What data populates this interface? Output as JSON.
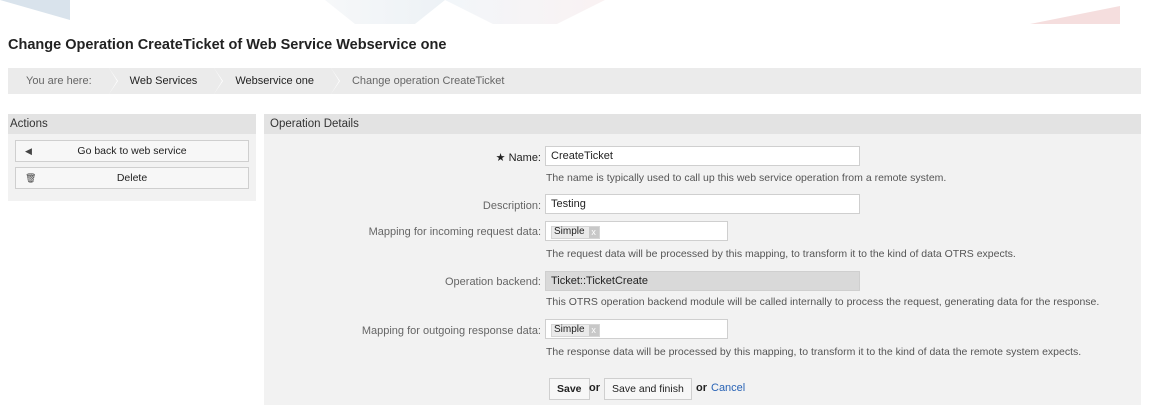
{
  "page_title": "Change Operation CreateTicket of Web Service Webservice one",
  "breadcrumb": {
    "prefix": "You are here:",
    "items": [
      "Web Services",
      "Webservice one",
      "Change operation CreateTicket"
    ]
  },
  "sidebar": {
    "title": "Actions",
    "go_back_label": "Go back to web service",
    "delete_label": "Delete"
  },
  "main": {
    "title": "Operation Details",
    "name": {
      "required_mark": "★",
      "label": "Name:",
      "value": "CreateTicket",
      "hint": "The name is typically used to call up this web service operation from a remote system."
    },
    "description": {
      "label": "Description:",
      "value": "Testing"
    },
    "incoming": {
      "label": "Mapping for incoming request data:",
      "value": "Simple",
      "remove": "x",
      "hint": "The request data will be processed by this mapping, to transform it to the kind of data OTRS expects."
    },
    "backend": {
      "label": "Operation backend:",
      "value": "Ticket::TicketCreate",
      "hint": "This OTRS operation backend module will be called internally to process the request, generating data for the response."
    },
    "outgoing": {
      "label": "Mapping for outgoing response data:",
      "value": "Simple",
      "remove": "x",
      "hint": "The response data will be processed by this mapping, to transform it to the kind of data the remote system expects."
    },
    "buttons": {
      "save": "Save",
      "or1": "or",
      "save_finish": "Save and finish",
      "or2": "or",
      "cancel": "Cancel"
    }
  },
  "icons": {
    "back": "chevron-left-icon",
    "delete": "trash-icon"
  }
}
